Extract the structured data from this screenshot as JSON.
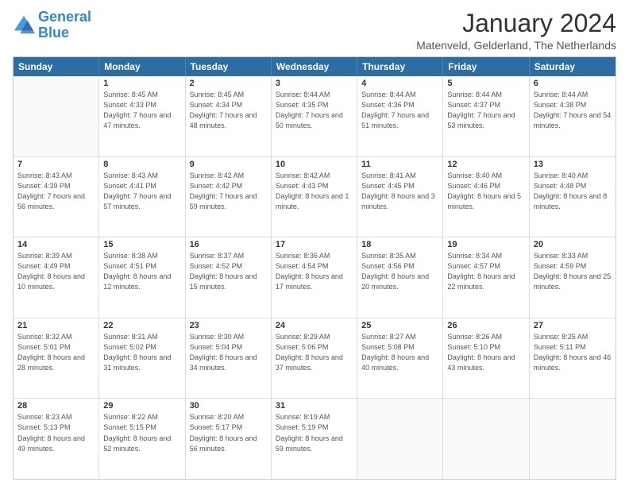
{
  "logo": {
    "line1": "General",
    "line2": "Blue"
  },
  "title": "January 2024",
  "subtitle": "Matenveld, Gelderland, The Netherlands",
  "calendar": {
    "days": [
      "Sunday",
      "Monday",
      "Tuesday",
      "Wednesday",
      "Thursday",
      "Friday",
      "Saturday"
    ],
    "rows": [
      [
        {
          "date": "",
          "sunrise": "",
          "sunset": "",
          "daylight": ""
        },
        {
          "date": "1",
          "sunrise": "8:45 AM",
          "sunset": "4:33 PM",
          "daylight": "7 hours and 47 minutes."
        },
        {
          "date": "2",
          "sunrise": "8:45 AM",
          "sunset": "4:34 PM",
          "daylight": "7 hours and 48 minutes."
        },
        {
          "date": "3",
          "sunrise": "8:44 AM",
          "sunset": "4:35 PM",
          "daylight": "7 hours and 50 minutes."
        },
        {
          "date": "4",
          "sunrise": "8:44 AM",
          "sunset": "4:36 PM",
          "daylight": "7 hours and 51 minutes."
        },
        {
          "date": "5",
          "sunrise": "8:44 AM",
          "sunset": "4:37 PM",
          "daylight": "7 hours and 53 minutes."
        },
        {
          "date": "6",
          "sunrise": "8:44 AM",
          "sunset": "4:38 PM",
          "daylight": "7 hours and 54 minutes."
        }
      ],
      [
        {
          "date": "7",
          "sunrise": "8:43 AM",
          "sunset": "4:39 PM",
          "daylight": "7 hours and 56 minutes."
        },
        {
          "date": "8",
          "sunrise": "8:43 AM",
          "sunset": "4:41 PM",
          "daylight": "7 hours and 57 minutes."
        },
        {
          "date": "9",
          "sunrise": "8:42 AM",
          "sunset": "4:42 PM",
          "daylight": "7 hours and 59 minutes."
        },
        {
          "date": "10",
          "sunrise": "8:42 AM",
          "sunset": "4:43 PM",
          "daylight": "8 hours and 1 minute."
        },
        {
          "date": "11",
          "sunrise": "8:41 AM",
          "sunset": "4:45 PM",
          "daylight": "8 hours and 3 minutes."
        },
        {
          "date": "12",
          "sunrise": "8:40 AM",
          "sunset": "4:46 PM",
          "daylight": "8 hours and 5 minutes."
        },
        {
          "date": "13",
          "sunrise": "8:40 AM",
          "sunset": "4:48 PM",
          "daylight": "8 hours and 8 minutes."
        }
      ],
      [
        {
          "date": "14",
          "sunrise": "8:39 AM",
          "sunset": "4:49 PM",
          "daylight": "8 hours and 10 minutes."
        },
        {
          "date": "15",
          "sunrise": "8:38 AM",
          "sunset": "4:51 PM",
          "daylight": "8 hours and 12 minutes."
        },
        {
          "date": "16",
          "sunrise": "8:37 AM",
          "sunset": "4:52 PM",
          "daylight": "8 hours and 15 minutes."
        },
        {
          "date": "17",
          "sunrise": "8:36 AM",
          "sunset": "4:54 PM",
          "daylight": "8 hours and 17 minutes."
        },
        {
          "date": "18",
          "sunrise": "8:35 AM",
          "sunset": "4:56 PM",
          "daylight": "8 hours and 20 minutes."
        },
        {
          "date": "19",
          "sunrise": "8:34 AM",
          "sunset": "4:57 PM",
          "daylight": "8 hours and 22 minutes."
        },
        {
          "date": "20",
          "sunrise": "8:33 AM",
          "sunset": "4:59 PM",
          "daylight": "8 hours and 25 minutes."
        }
      ],
      [
        {
          "date": "21",
          "sunrise": "8:32 AM",
          "sunset": "5:01 PM",
          "daylight": "8 hours and 28 minutes."
        },
        {
          "date": "22",
          "sunrise": "8:31 AM",
          "sunset": "5:02 PM",
          "daylight": "8 hours and 31 minutes."
        },
        {
          "date": "23",
          "sunrise": "8:30 AM",
          "sunset": "5:04 PM",
          "daylight": "8 hours and 34 minutes."
        },
        {
          "date": "24",
          "sunrise": "8:29 AM",
          "sunset": "5:06 PM",
          "daylight": "8 hours and 37 minutes."
        },
        {
          "date": "25",
          "sunrise": "8:27 AM",
          "sunset": "5:08 PM",
          "daylight": "8 hours and 40 minutes."
        },
        {
          "date": "26",
          "sunrise": "8:26 AM",
          "sunset": "5:10 PM",
          "daylight": "8 hours and 43 minutes."
        },
        {
          "date": "27",
          "sunrise": "8:25 AM",
          "sunset": "5:11 PM",
          "daylight": "8 hours and 46 minutes."
        }
      ],
      [
        {
          "date": "28",
          "sunrise": "8:23 AM",
          "sunset": "5:13 PM",
          "daylight": "8 hours and 49 minutes."
        },
        {
          "date": "29",
          "sunrise": "8:22 AM",
          "sunset": "5:15 PM",
          "daylight": "8 hours and 52 minutes."
        },
        {
          "date": "30",
          "sunrise": "8:20 AM",
          "sunset": "5:17 PM",
          "daylight": "8 hours and 56 minutes."
        },
        {
          "date": "31",
          "sunrise": "8:19 AM",
          "sunset": "5:19 PM",
          "daylight": "8 hours and 59 minutes."
        },
        {
          "date": "",
          "sunrise": "",
          "sunset": "",
          "daylight": ""
        },
        {
          "date": "",
          "sunrise": "",
          "sunset": "",
          "daylight": ""
        },
        {
          "date": "",
          "sunrise": "",
          "sunset": "",
          "daylight": ""
        }
      ]
    ]
  }
}
